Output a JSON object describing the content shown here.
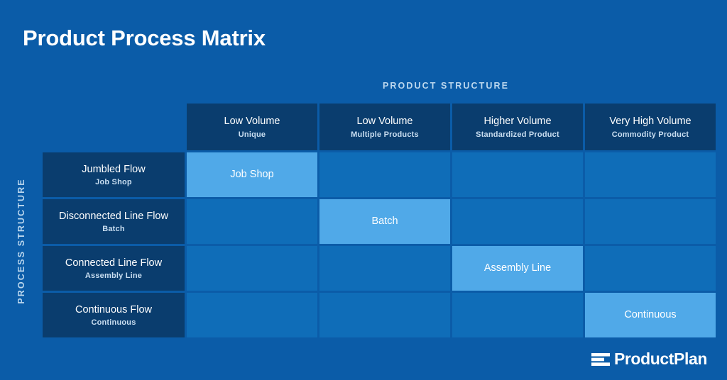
{
  "page": {
    "title": "Product Process Matrix",
    "background_color": "#0B5CA8"
  },
  "axes": {
    "column_axis_label": "PRODUCT STRUCTURE",
    "row_axis_label": "PROCESS STRUCTURE"
  },
  "colors": {
    "header_cell": "#0A3D6E",
    "body_cell": "#0F6DB8",
    "active_cell": "#50A9E8",
    "caption_text": "#BBD7EE"
  },
  "columns": [
    {
      "main": "Low Volume",
      "sub": "Unique"
    },
    {
      "main": "Low Volume",
      "sub": "Multiple Products"
    },
    {
      "main": "Higher Volume",
      "sub": "Standardized Product"
    },
    {
      "main": "Very High Volume",
      "sub": "Commodity Product"
    }
  ],
  "rows": [
    {
      "main": "Jumbled Flow",
      "sub": "Job Shop"
    },
    {
      "main": "Disconnected Line Flow",
      "sub": "Batch"
    },
    {
      "main": "Connected Line Flow",
      "sub": "Assembly Line"
    },
    {
      "main": "Continuous Flow",
      "sub": "Continuous"
    }
  ],
  "matrix": [
    [
      {
        "label": "Job Shop",
        "active": true
      },
      {
        "label": "",
        "active": false
      },
      {
        "label": "",
        "active": false
      },
      {
        "label": "",
        "active": false
      }
    ],
    [
      {
        "label": "",
        "active": false
      },
      {
        "label": "Batch",
        "active": true
      },
      {
        "label": "",
        "active": false
      },
      {
        "label": "",
        "active": false
      }
    ],
    [
      {
        "label": "",
        "active": false
      },
      {
        "label": "",
        "active": false
      },
      {
        "label": "Assembly Line",
        "active": true
      },
      {
        "label": "",
        "active": false
      }
    ],
    [
      {
        "label": "",
        "active": false
      },
      {
        "label": "",
        "active": false
      },
      {
        "label": "",
        "active": false
      },
      {
        "label": "Continuous",
        "active": true
      }
    ]
  ],
  "branding": {
    "logo_text": "ProductPlan",
    "logo_icon": "productplan-bars-icon"
  }
}
